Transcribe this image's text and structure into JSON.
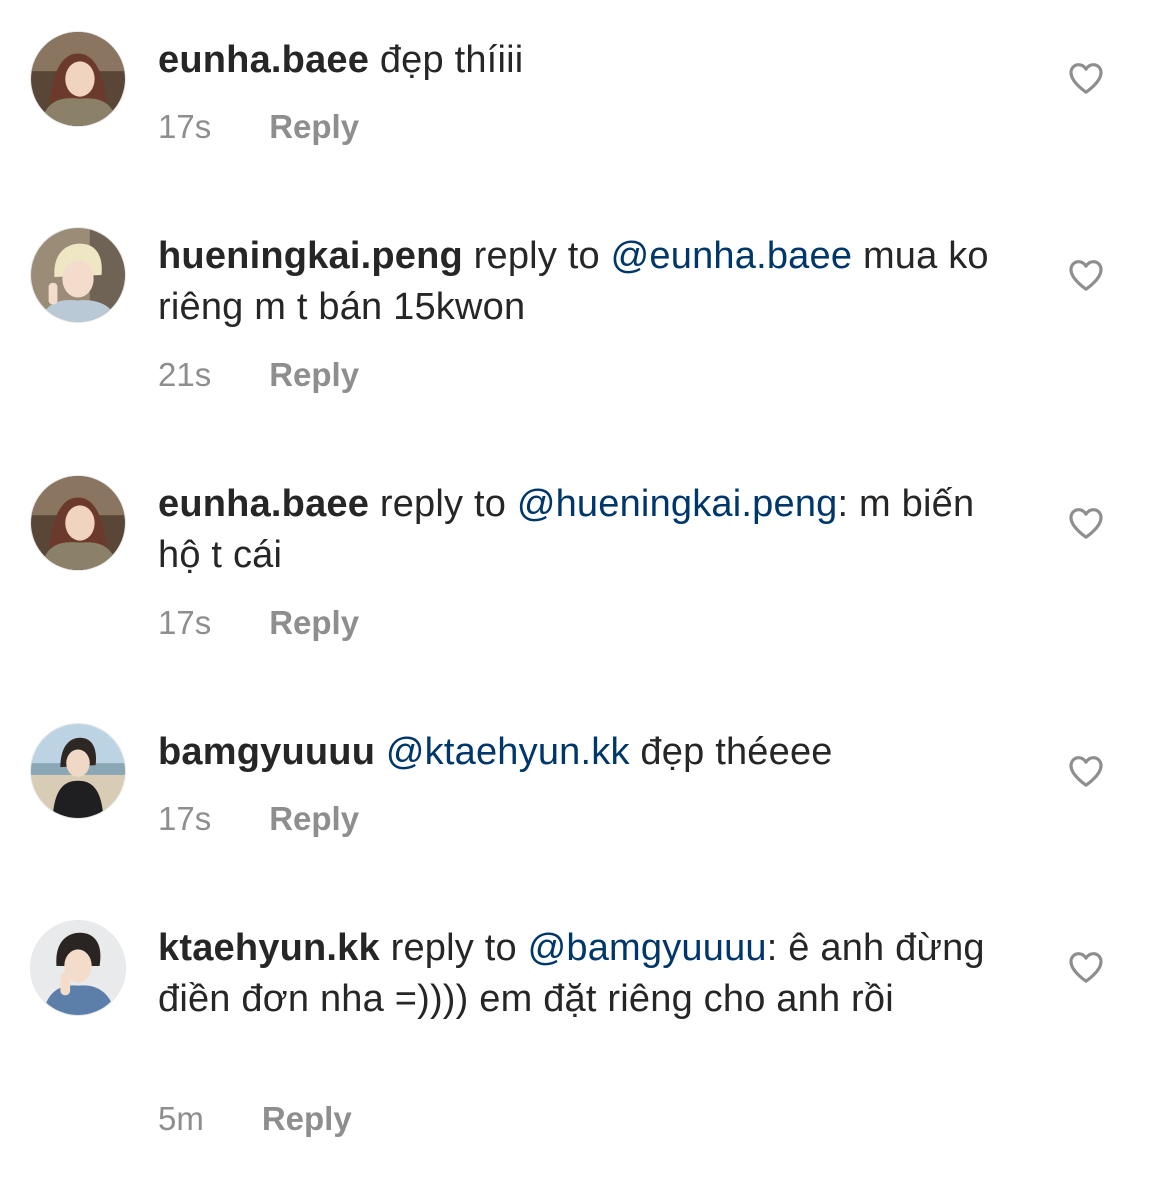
{
  "comments": [
    {
      "username": "eunha.baee",
      "prefix": "",
      "mention": "",
      "body": " đẹp thíiii",
      "time": "17s",
      "reply_label": "Reply",
      "avatar": "girl-long-hair-avatar"
    },
    {
      "username": "hueningkai.peng",
      "prefix": " reply to ",
      "mention": "@eunha.baee",
      "body": " mua ko riêng m t bán 15kwon",
      "time": "21s",
      "reply_label": "Reply",
      "avatar": "blond-boy-peace-sign-avatar"
    },
    {
      "username": "eunha.baee",
      "prefix": " reply to ",
      "mention": "@hueningkai.peng",
      "body": ": m biến hộ t cái",
      "time": "17s",
      "reply_label": "Reply",
      "avatar": "girl-long-hair-avatar"
    },
    {
      "username": "bamgyuuuu",
      "prefix": " ",
      "mention": "@ktaehyun.kk",
      "body": " đẹp théeee",
      "time": "17s",
      "reply_label": "Reply",
      "avatar": "boy-on-beach-avatar"
    },
    {
      "username": "ktaehyun.kk",
      "prefix": " reply to ",
      "mention": "@bamgyuuuu",
      "body": ": ê anh đừng điền đơn nha =)))) em đặt riêng cho anh rồi",
      "time": "5m",
      "reply_label": "Reply",
      "avatar": "boy-denim-jacket-avatar"
    }
  ],
  "colors": {
    "text": "#262626",
    "mention": "#00376b",
    "meta": "#8e8e8e",
    "heart_stroke": "#8e8e8e"
  },
  "icons": {
    "like": "heart-outline-icon"
  }
}
